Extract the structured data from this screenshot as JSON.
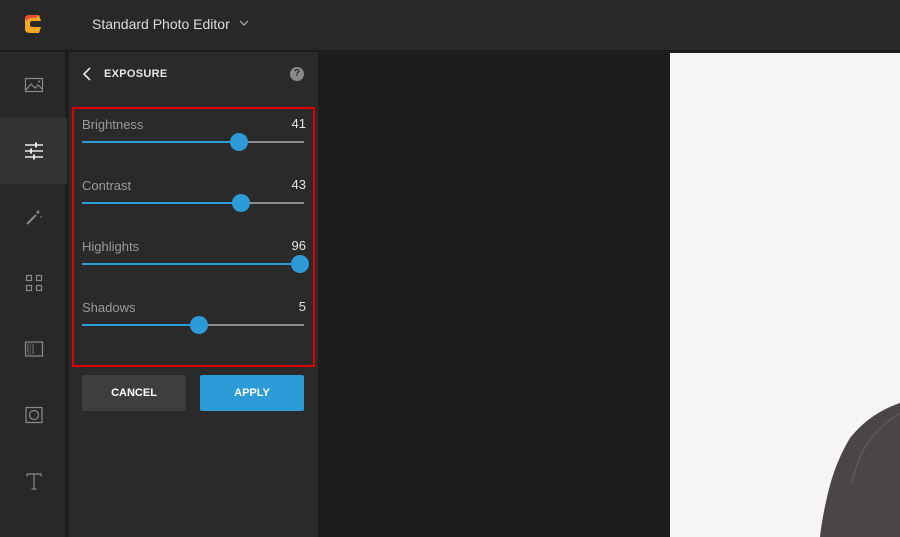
{
  "app": {
    "title": "Standard Photo Editor",
    "logo_icon": "app-logo-icon",
    "brand_color": "#f08a24"
  },
  "rail": {
    "items": [
      {
        "name": "image",
        "icon": "image-icon",
        "active": false
      },
      {
        "name": "adjust",
        "icon": "sliders-icon",
        "active": true
      },
      {
        "name": "effects",
        "icon": "magic-wand-icon",
        "active": false
      },
      {
        "name": "frames",
        "icon": "grid-icon",
        "active": false
      },
      {
        "name": "overlays",
        "icon": "texture-icon",
        "active": false
      },
      {
        "name": "vignette",
        "icon": "vignette-icon",
        "active": false
      },
      {
        "name": "text",
        "icon": "text-icon",
        "active": false
      }
    ]
  },
  "panel": {
    "title": "EXPOSURE",
    "help_label": "?",
    "sliders": [
      {
        "label": "Brightness",
        "value": "41",
        "fraction": 0.705
      },
      {
        "label": "Contrast",
        "value": "43",
        "fraction": 0.715
      },
      {
        "label": "Highlights",
        "value": "96",
        "fraction": 0.98
      },
      {
        "label": "Shadows",
        "value": "5",
        "fraction": 0.525
      }
    ],
    "slider_range": [
      -100,
      100
    ],
    "cancel_label": "CANCEL",
    "apply_label": "APPLY",
    "accent_color": "#2d9bd8",
    "highlight_border_color": "#e00000"
  }
}
